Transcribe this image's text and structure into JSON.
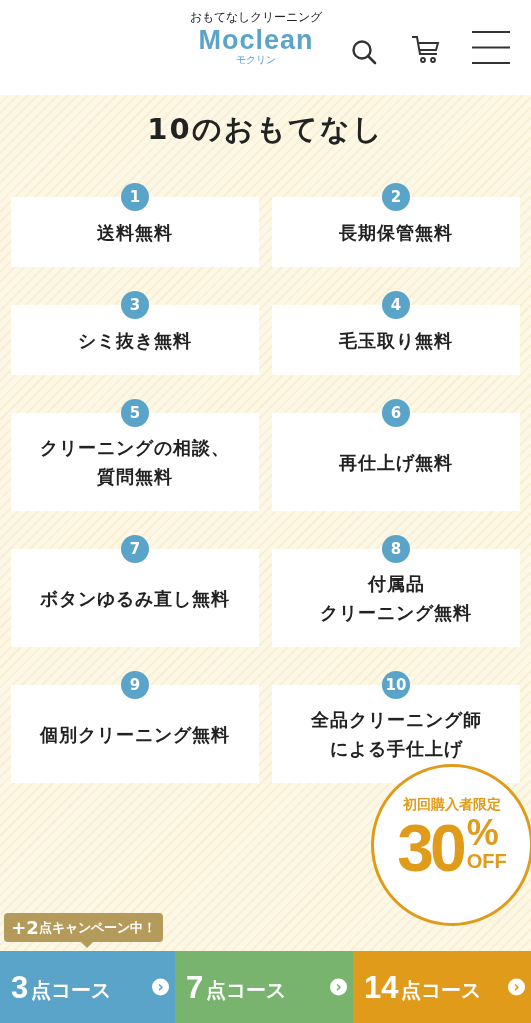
{
  "header": {
    "tagline": "おもてなしクリーニング",
    "logo": "Moclean",
    "logo_reading": "モクリン"
  },
  "section": {
    "title": "10のおもてなし",
    "items": [
      {
        "number": "1",
        "text": "送料無料"
      },
      {
        "number": "2",
        "text": "長期保管無料"
      },
      {
        "number": "3",
        "text": "シミ抜き無料"
      },
      {
        "number": "4",
        "text": "毛玉取り無料"
      },
      {
        "number": "5",
        "lines": [
          "クリーニングの相談、",
          "質問無料"
        ]
      },
      {
        "number": "6",
        "text": "再仕上げ無料"
      },
      {
        "number": "7",
        "text": "ボタンゆるみ直し無料"
      },
      {
        "number": "8",
        "lines": [
          "付属品",
          "クリーニング無料"
        ]
      },
      {
        "number": "9",
        "text": "個別クリーニング無料"
      },
      {
        "number": "10",
        "lines": [
          "全品クリーニング師",
          "による手仕上げ"
        ]
      }
    ]
  },
  "promo": {
    "label": "初回購入者限定",
    "number": "30",
    "percent": "%",
    "off": "OFF"
  },
  "campaign": {
    "big": "+2",
    "rest": "点キャンペーン中！"
  },
  "courses": [
    {
      "number": "3",
      "unit": "点コース",
      "arrow": "›",
      "color": "#5ba4c9"
    },
    {
      "number": "7",
      "unit": "点コース",
      "arrow": "›",
      "color": "#78b46e"
    },
    {
      "number": "14",
      "unit": "点コース",
      "arrow": "›",
      "color": "#e09b1b"
    }
  ]
}
